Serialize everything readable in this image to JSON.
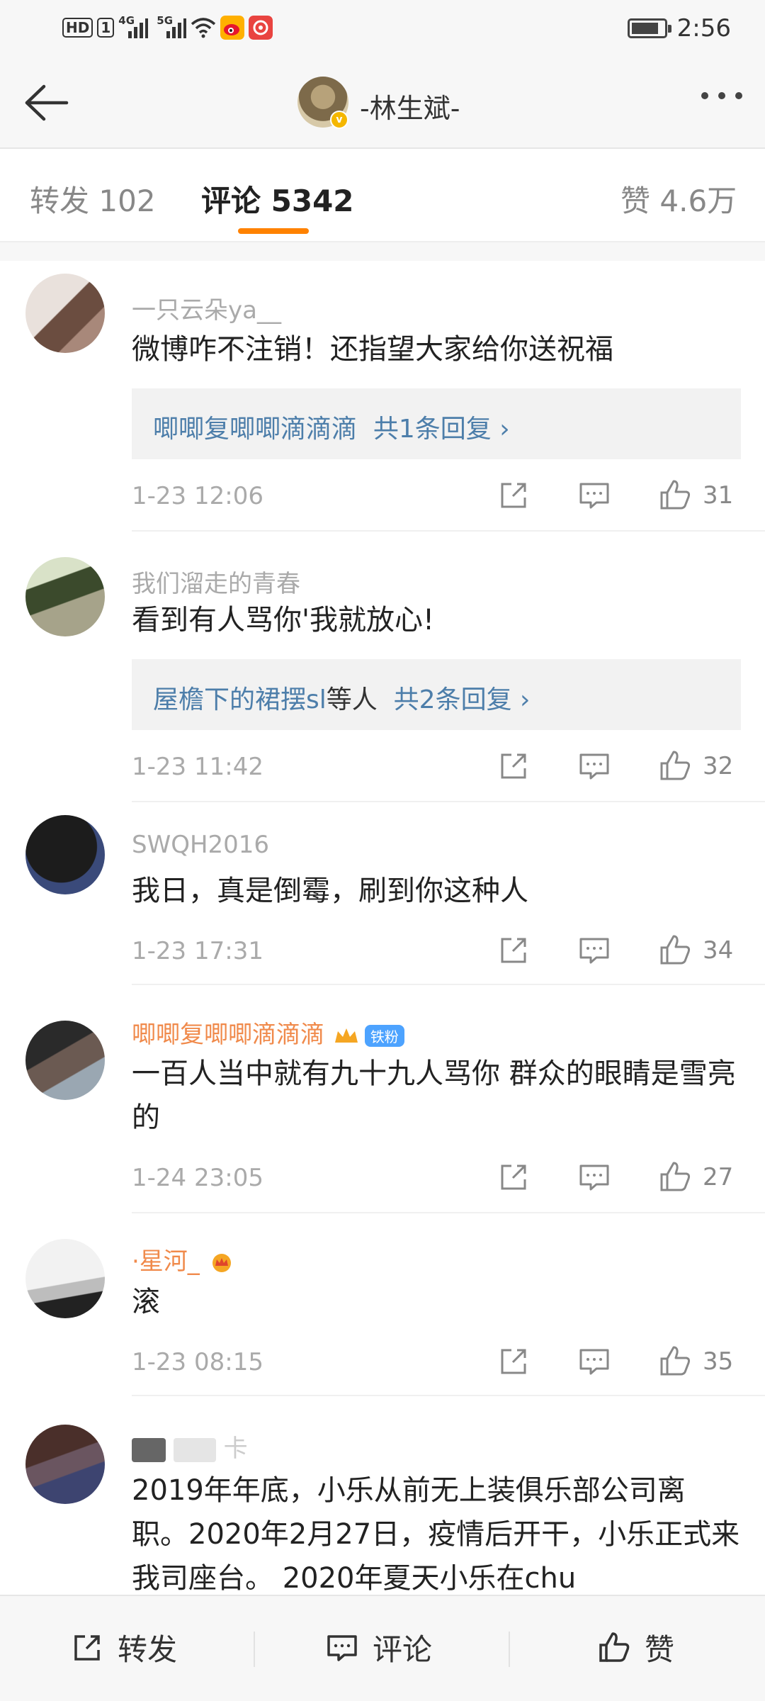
{
  "status_bar": {
    "badge_hd": "HD",
    "badge_sim": "1",
    "net_1": "4G",
    "net_2": "5G",
    "time": "2:56",
    "battery_level": 0.85
  },
  "header": {
    "title": "-林生斌-",
    "verified_mark": "v"
  },
  "tabs": [
    {
      "label": "转发",
      "count": "102"
    },
    {
      "label": "评论",
      "count": "5342"
    },
    {
      "label": "赞",
      "count": "4.6万"
    }
  ],
  "comments": [
    {
      "username": "一只云朵ya__",
      "text": "微博咋不注销！还指望大家给你送祝福",
      "reply": {
        "names": "唧唧复唧唧滴滴滴",
        "others": "",
        "summary": "共1条回复 ›"
      },
      "time": "1-23 12:06",
      "likes": "31"
    },
    {
      "username": "我们溜走的青春",
      "text": "看到有人骂你'我就放心!",
      "reply": {
        "names": "屋檐下的裙摆sl",
        "others": "等人",
        "summary": "共2条回复 ›"
      },
      "time": "1-23 11:42",
      "likes": "32"
    },
    {
      "username": "SWQH2016",
      "text": "我日，真是倒霉，刷到你这种人",
      "time": "1-23 17:31",
      "likes": "34"
    },
    {
      "username": "唧唧复唧唧滴滴滴",
      "user_badge": "铁粉",
      "text": "一百人当中就有九十九人骂你 群众的眼睛是雪亮的",
      "time": "1-24 23:05",
      "likes": "27"
    },
    {
      "username": "·星河_",
      "text": "滚",
      "time": "1-23 08:15",
      "likes": "35"
    },
    {
      "username": "卡",
      "text": "2019年年底，小乐从前无上装俱乐部公司离职。2020年2月27日，疫情后开干，小乐正式来我司座台。 2020年夏天小乐在chu"
    }
  ],
  "bottom_bar": {
    "repost": "转发",
    "comment": "评论",
    "like": "赞"
  },
  "colors": {
    "accent": "#ff8200",
    "link": "#4d7eaa",
    "fan_badge": "#4da3ff"
  },
  "icons": [
    "back-arrow-icon",
    "more-dots-icon",
    "share-icon",
    "comment-icon",
    "like-icon",
    "vip-crown-icon"
  ]
}
